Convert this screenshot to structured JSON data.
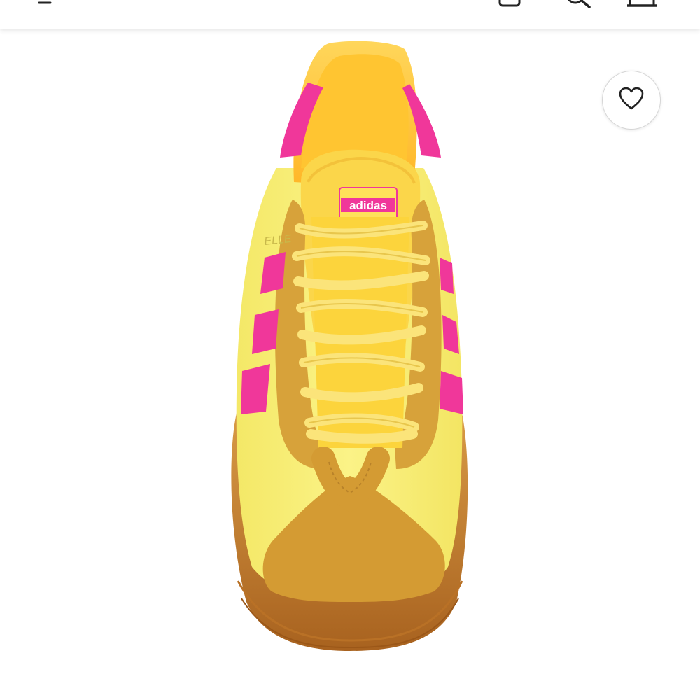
{
  "header": {
    "icons": [
      "back-icon",
      "account-icon",
      "search-icon",
      "bag-icon"
    ]
  },
  "product_image": {
    "brand_label": "adidas",
    "model_partial": "ELLE",
    "colors": {
      "upper": "#f7ef6e",
      "stripes": "#f0379a",
      "suede": "#d7a23a",
      "laces": "#fbe36e",
      "sole": "#c07a2e",
      "lining": "#ffc93e"
    }
  },
  "favorite_button": {
    "icon": "heart-outline-icon"
  }
}
